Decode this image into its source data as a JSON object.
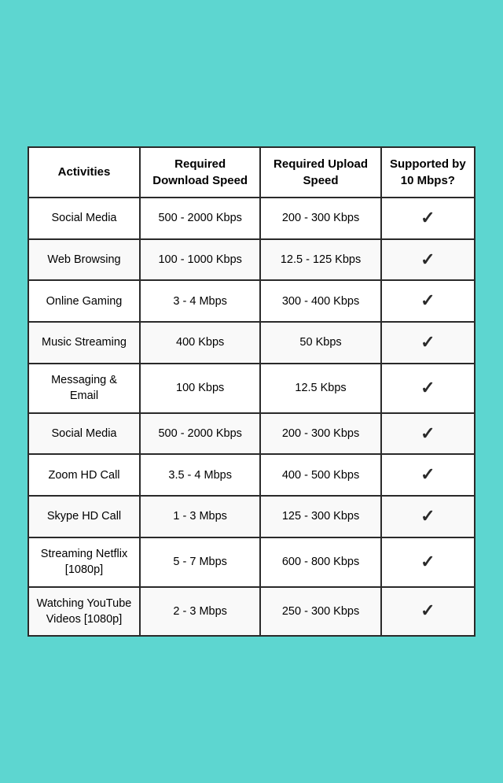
{
  "table": {
    "headers": {
      "activity": "Activities",
      "download": "Required Download Speed",
      "upload": "Required Upload Speed",
      "supported": "Supported by 10 Mbps?"
    },
    "rows": [
      {
        "activity": "Social Media",
        "download": "500 - 2000 Kbps",
        "upload": "200 - 300 Kbps",
        "supported": "✓"
      },
      {
        "activity": "Web Browsing",
        "download": "100 - 1000 Kbps",
        "upload": "12.5 - 125 Kbps",
        "supported": "✓"
      },
      {
        "activity": "Online Gaming",
        "download": "3 - 4 Mbps",
        "upload": "300 - 400 Kbps",
        "supported": "✓"
      },
      {
        "activity": "Music Streaming",
        "download": "400 Kbps",
        "upload": "50 Kbps",
        "supported": "✓"
      },
      {
        "activity": "Messaging & Email",
        "download": "100 Kbps",
        "upload": "12.5 Kbps",
        "supported": "✓"
      },
      {
        "activity": "Social Media",
        "download": "500 - 2000 Kbps",
        "upload": "200 - 300 Kbps",
        "supported": "✓"
      },
      {
        "activity": "Zoom HD Call",
        "download": "3.5 - 4 Mbps",
        "upload": "400 - 500 Kbps",
        "supported": "✓"
      },
      {
        "activity": "Skype HD Call",
        "download": "1 - 3 Mbps",
        "upload": "125 - 300 Kbps",
        "supported": "✓"
      },
      {
        "activity": "Streaming Netflix [1080p]",
        "download": "5 - 7 Mbps",
        "upload": "600 - 800 Kbps",
        "supported": "✓"
      },
      {
        "activity": "Watching YouTube Videos [1080p]",
        "download": "2 - 3 Mbps",
        "upload": "250 - 300 Kbps",
        "supported": "✓"
      }
    ]
  }
}
